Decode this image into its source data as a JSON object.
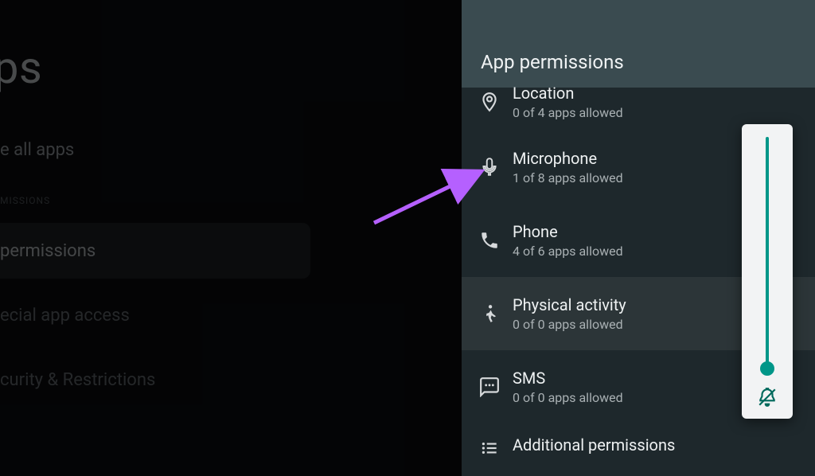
{
  "left": {
    "title_fragment": "pps",
    "see_all": "e all apps",
    "permissions_header": "MISSIONS",
    "selected_item": "permissions",
    "special_access": "ecial app access",
    "security": "curity & Restrictions"
  },
  "drawer": {
    "title": "App permissions",
    "items": [
      {
        "key": "location",
        "title": "Location",
        "sub": "0 of 4 apps allowed",
        "icon": "location-pin-icon"
      },
      {
        "key": "microphone",
        "title": "Microphone",
        "sub": "1 of 8 apps allowed",
        "icon": "microphone-icon"
      },
      {
        "key": "phone",
        "title": "Phone",
        "sub": "4 of 6 apps allowed",
        "icon": "phone-icon"
      },
      {
        "key": "activity",
        "title": "Physical activity",
        "sub": "0 of 0 apps allowed",
        "icon": "running-icon"
      },
      {
        "key": "sms",
        "title": "SMS",
        "sub": "0 of 0 apps allowed",
        "icon": "sms-icon"
      },
      {
        "key": "additional",
        "title": "Additional permissions",
        "sub": "",
        "icon": "more-list-icon"
      }
    ]
  },
  "annotation": {
    "arrow_color": "#b560ff"
  },
  "volume": {
    "accent": "#009688",
    "muted": true,
    "level_percent": 0
  }
}
